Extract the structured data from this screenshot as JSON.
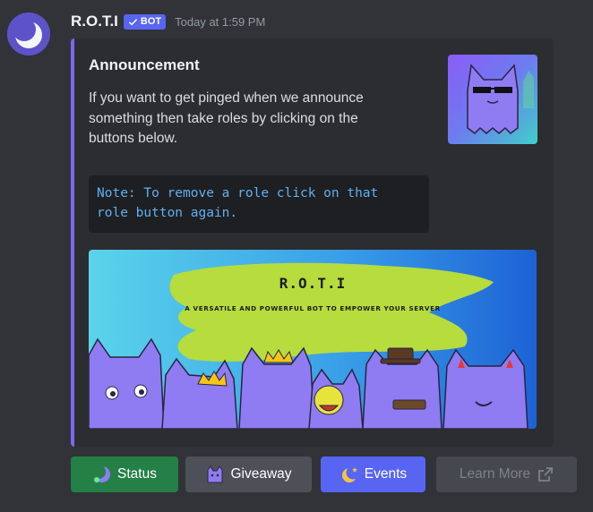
{
  "message": {
    "username": "R.O.T.I",
    "bot_tag": "BOT",
    "timestamp": "Today at 1:59 PM",
    "avatar_icon": "crescent-moon-icon"
  },
  "embed": {
    "accent_color": "#7c67f2",
    "title": "Announcement",
    "description_lines": [
      "If you want to get pinged when we announce",
      "something then take roles by clicking on the",
      "buttons below."
    ],
    "code_lines": [
      "Note: To remove a role click on that",
      "role button again."
    ],
    "banner": {
      "title": "R.O.T.I",
      "subtitle": "A VERSATILE AND POWERFUL BOT TO EMPOWER YOUR SERVER"
    }
  },
  "buttons": [
    {
      "label": "Status",
      "style": "success",
      "color": "#248046",
      "icon": "crescent-moon-icon"
    },
    {
      "label": "Giveaway",
      "style": "secondary",
      "color": "#4e5058",
      "icon": "purple-cat-icon"
    },
    {
      "label": "Events",
      "style": "primary",
      "color": "#5865f2",
      "icon": "crescent-moon-star-icon"
    },
    {
      "label": "Learn More",
      "style": "link",
      "color": "#4e5058",
      "icon": "external-link-icon",
      "disabled": true
    }
  ]
}
